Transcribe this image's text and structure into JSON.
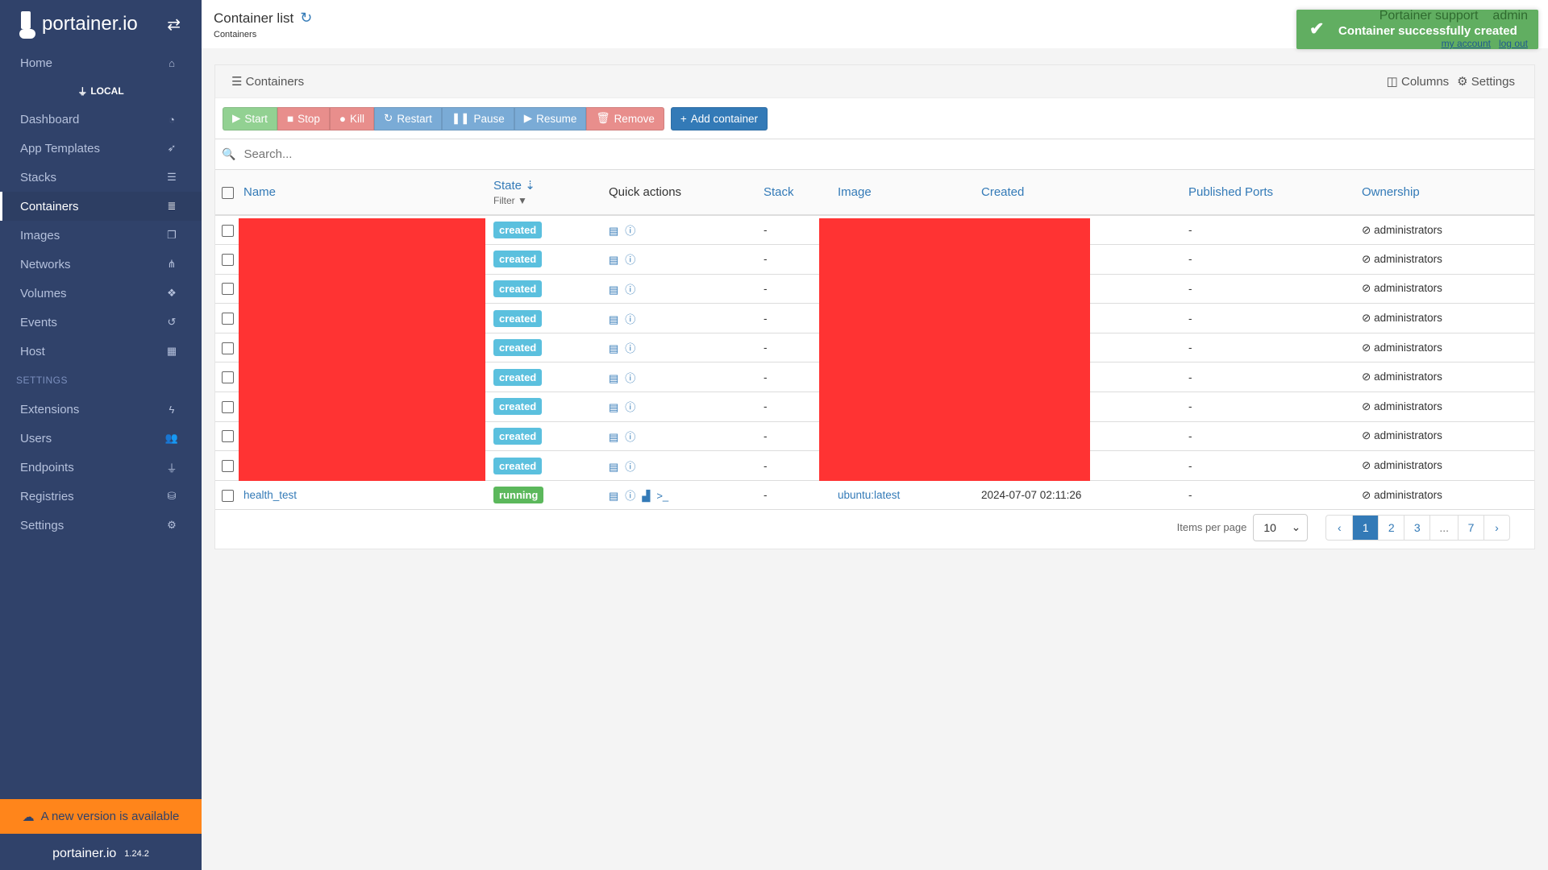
{
  "sidebar": {
    "brand": "portainer.io",
    "home": "Home",
    "endpoint": "LOCAL",
    "items": [
      {
        "label": "Dashboard",
        "icon": "tachometer-icon"
      },
      {
        "label": "App Templates",
        "icon": "rocket-icon"
      },
      {
        "label": "Stacks",
        "icon": "list-icon"
      },
      {
        "label": "Containers",
        "icon": "server-icon",
        "active": true
      },
      {
        "label": "Images",
        "icon": "clone-icon"
      },
      {
        "label": "Networks",
        "icon": "sitemap-icon"
      },
      {
        "label": "Volumes",
        "icon": "cubes-icon"
      },
      {
        "label": "Events",
        "icon": "history-icon"
      },
      {
        "label": "Host",
        "icon": "th-icon"
      }
    ],
    "settings_section": "SETTINGS",
    "settings_items": [
      {
        "label": "Extensions",
        "icon": "bolt-icon"
      },
      {
        "label": "Users",
        "icon": "users-icon"
      },
      {
        "label": "Endpoints",
        "icon": "plug-icon"
      },
      {
        "label": "Registries",
        "icon": "database-icon"
      },
      {
        "label": "Settings",
        "icon": "cogs-icon"
      }
    ],
    "update_banner": "A new version is available",
    "footer_brand": "portainer.io",
    "version": "1.24.2"
  },
  "header": {
    "title": "Container list",
    "breadcrumb": "Containers",
    "support": "Portainer support",
    "user": "admin",
    "my_account": "my account",
    "logout": "log out"
  },
  "toast": {
    "message": "Container successfully created",
    "color": "#5cb85c"
  },
  "panel": {
    "title": "Containers",
    "columns_label": "Columns",
    "settings_label": "Settings",
    "actions": {
      "start": "Start",
      "stop": "Stop",
      "kill": "Kill",
      "restart": "Restart",
      "pause": "Pause",
      "resume": "Resume",
      "remove": "Remove",
      "add": "Add container"
    },
    "search_placeholder": "Search...",
    "headers": {
      "name": "Name",
      "state": "State",
      "filter": "Filter",
      "quick_actions": "Quick actions",
      "stack": "Stack",
      "image": "Image",
      "created": "Created",
      "ports": "Published Ports",
      "ownership": "Ownership"
    },
    "rows": [
      {
        "name": "",
        "state": "created",
        "stack": "-",
        "image": "",
        "created": "",
        "ports": "-",
        "ownership": "administrators"
      },
      {
        "name": "",
        "state": "created",
        "stack": "-",
        "image": "",
        "created": "",
        "ports": "-",
        "ownership": "administrators"
      },
      {
        "name": "",
        "state": "created",
        "stack": "-",
        "image": "",
        "created": "",
        "ports": "-",
        "ownership": "administrators"
      },
      {
        "name": "",
        "state": "created",
        "stack": "-",
        "image": "",
        "created": "",
        "ports": "-",
        "ownership": "administrators"
      },
      {
        "name": "",
        "state": "created",
        "stack": "-",
        "image": "",
        "created": "",
        "ports": "-",
        "ownership": "administrators"
      },
      {
        "name": "",
        "state": "created",
        "stack": "-",
        "image": "",
        "created": "",
        "ports": "-",
        "ownership": "administrators"
      },
      {
        "name": "",
        "state": "created",
        "stack": "-",
        "image": "",
        "created": "",
        "ports": "-",
        "ownership": "administrators"
      },
      {
        "name": "",
        "state": "created",
        "stack": "-",
        "image": "",
        "created": "",
        "ports": "-",
        "ownership": "administrators"
      },
      {
        "name": "",
        "state": "created",
        "stack": "-",
        "image": "",
        "created": "",
        "ports": "-",
        "ownership": "administrators"
      },
      {
        "name": "health_test",
        "state": "running",
        "stack": "-",
        "image": "ubuntu:latest",
        "created": "2024-07-07 02:11:26",
        "ports": "-",
        "ownership": "administrators"
      }
    ],
    "pagination": {
      "items_per_page_label": "Items per page",
      "items_per_page": "10",
      "pages": [
        "‹",
        "1",
        "2",
        "3",
        "...",
        "7",
        "›"
      ],
      "current": "1"
    }
  }
}
